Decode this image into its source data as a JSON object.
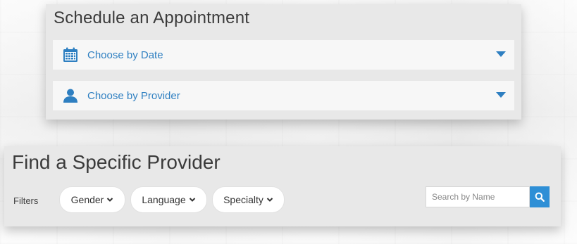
{
  "schedule": {
    "title": "Schedule an Appointment",
    "rows": [
      {
        "label": "Choose by Date",
        "icon": "calendar-icon"
      },
      {
        "label": "Choose by Provider",
        "icon": "person-icon"
      }
    ]
  },
  "find": {
    "title": "Find a Specific Provider",
    "filters_label": "Filters",
    "filters": [
      {
        "label": "Gender"
      },
      {
        "label": "Language"
      },
      {
        "label": "Specialty"
      }
    ],
    "search": {
      "placeholder": "Search by Name",
      "value": "",
      "button_icon": "search-icon"
    }
  },
  "colors": {
    "accent": "#2e7fc1",
    "search_button": "#2e8fd6",
    "panel": "#e8e8e8",
    "row": "#f7f7f7"
  }
}
